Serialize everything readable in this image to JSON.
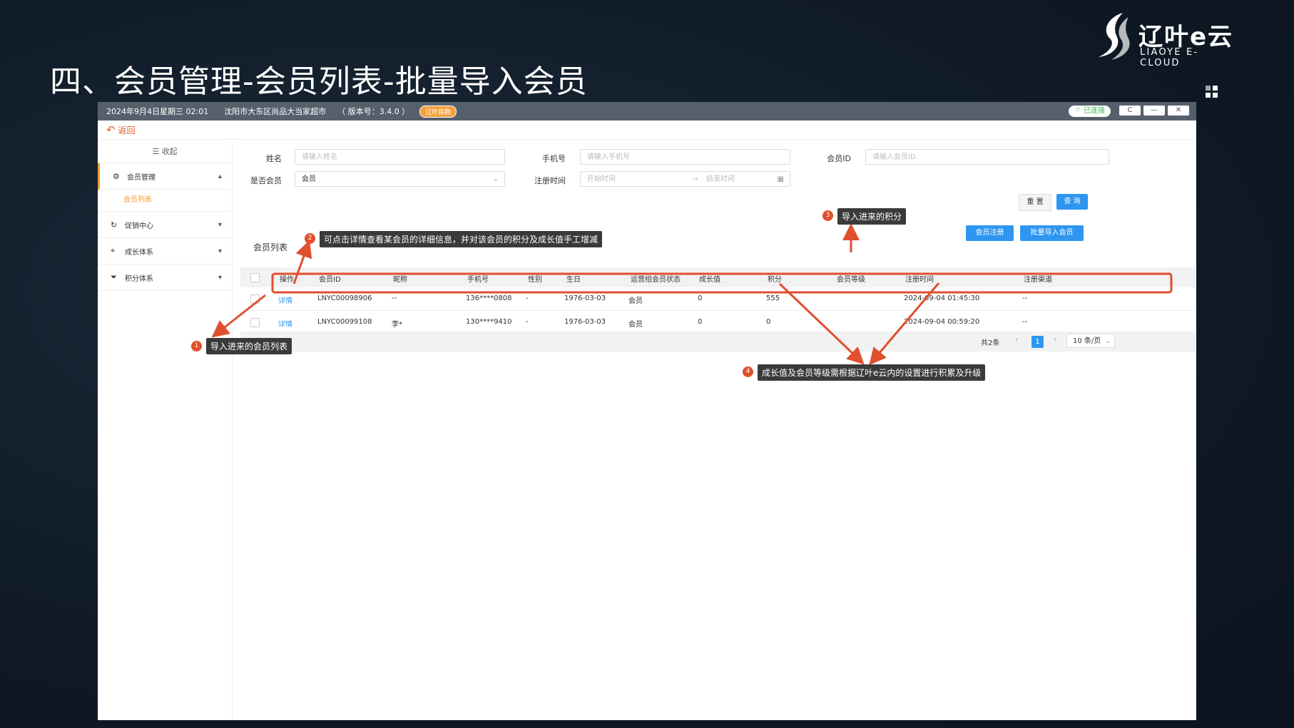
{
  "slide": {
    "title": "四、会员管理-会员列表-批量导入会员",
    "brand_name": "辽叶e云",
    "brand_sub": "LIAOYE E-CLOUD"
  },
  "app": {
    "titlebar": {
      "datetime": "2024年9月4日星期三 02:01",
      "store": "沈阳市大东区尚品大当家超市",
      "version": "（ 版本号：3.4.0 ）",
      "badge": "辽叶指数",
      "connection": "已连接",
      "refresh_icon": "C",
      "minimize_icon": "—",
      "close_icon": "✕"
    },
    "back_label": "返回",
    "sidebar": {
      "collapse_label": "收起",
      "items": [
        {
          "label": "会员管理",
          "icon": "gear-icon",
          "chevron": "⌃"
        },
        {
          "label": "促销中心",
          "icon": "refresh-icon",
          "chevron": "⌄"
        },
        {
          "label": "成长体系",
          "icon": "tag-icon",
          "chevron": "⌄"
        },
        {
          "label": "积分体系",
          "icon": "funnel-icon",
          "chevron": "⌄"
        }
      ],
      "sub_item": "会员列表"
    },
    "filters": {
      "name_label": "姓名",
      "name_placeholder": "请输入姓名",
      "phone_label": "手机号",
      "phone_placeholder": "请输入手机号",
      "id_label": "会员ID",
      "id_placeholder": "请输入会员ID",
      "is_member_label": "是否会员",
      "is_member_value": "会员",
      "regtime_label": "注册时间",
      "start_placeholder": "开始时间",
      "end_placeholder": "结束时间",
      "reset_label": "重 置",
      "query_label": "查 询"
    },
    "list": {
      "title": "会员列表",
      "register_label": "会员注册",
      "import_label": "批量导入会员",
      "columns": [
        "操作",
        "会员ID",
        "昵称",
        "手机号",
        "性别",
        "生日",
        "运营组会员状态",
        "成长值",
        "积分",
        "会员等级",
        "注册时间",
        "注册渠道"
      ],
      "rows": [
        {
          "action": "详情",
          "id": "LNYC00098906",
          "nick": "--",
          "phone": "136****0808",
          "gender": "-",
          "birthday": "1976-03-03",
          "status": "会员",
          "growth": "0",
          "points": "555",
          "level": "",
          "regtime": "2024-09-04 01:45:30",
          "channel": "--"
        },
        {
          "action": "详情",
          "id": "LNYC00099108",
          "nick": "李*",
          "phone": "130****9410",
          "gender": "-",
          "birthday": "1976-03-03",
          "status": "会员",
          "growth": "0",
          "points": "0",
          "level": "",
          "regtime": "2024-09-04 00:59:20",
          "channel": "--"
        }
      ],
      "total": "共2条",
      "page": "1",
      "page_size": "10 条/页"
    }
  },
  "annotations": [
    {
      "num": "1",
      "text": "导入进来的会员列表"
    },
    {
      "num": "2",
      "text": "可点击详情查看某会员的详细信息，并对该会员的积分及成长值手工增减"
    },
    {
      "num": "3",
      "text": "导入进来的积分"
    },
    {
      "num": "4",
      "text": "成长值及会员等级需根据辽叶e云内的设置进行积累及升级"
    }
  ],
  "colors": {
    "accent": "#2e96f0",
    "highlight": "#e04f2e",
    "menu_active": "#f39c33"
  }
}
